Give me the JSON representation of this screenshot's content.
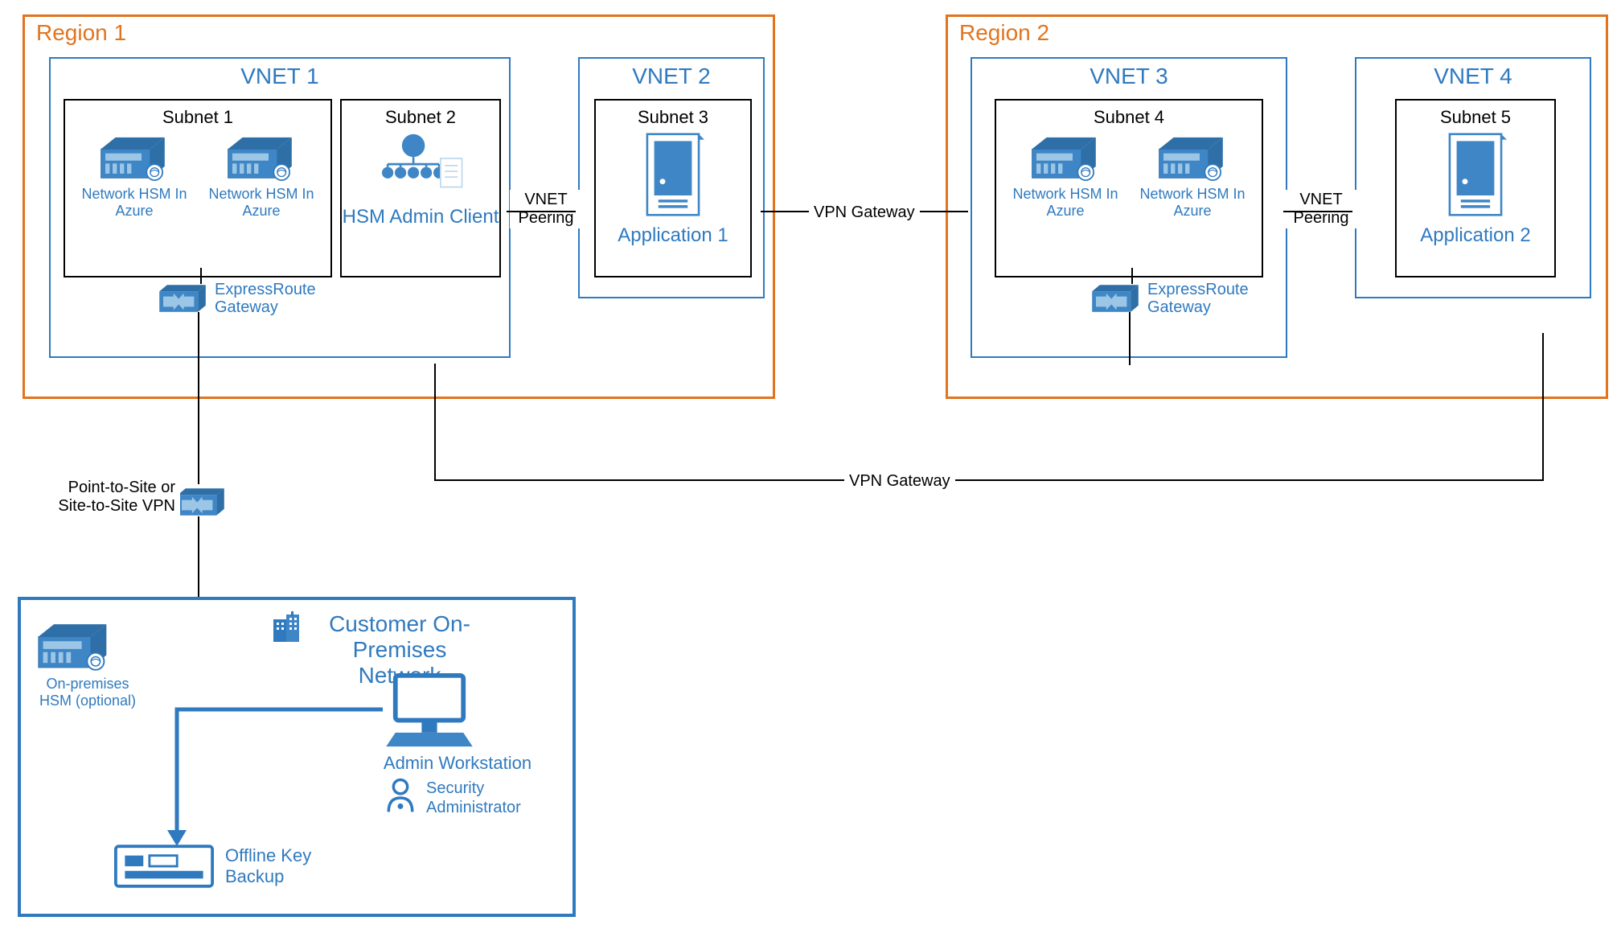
{
  "regions": [
    {
      "id": "region1",
      "title": "Region 1"
    },
    {
      "id": "region2",
      "title": "Region 2"
    }
  ],
  "vnets": {
    "vnet1": {
      "title": "VNET 1"
    },
    "vnet2": {
      "title": "VNET 2"
    },
    "vnet3": {
      "title": "VNET 3"
    },
    "vnet4": {
      "title": "VNET 4"
    }
  },
  "subnets": {
    "s1": {
      "title": "Subnet 1"
    },
    "s2": {
      "title": "Subnet 2"
    },
    "s3": {
      "title": "Subnet 3"
    },
    "s4": {
      "title": "Subnet 4"
    },
    "s5": {
      "title": "Subnet 5"
    }
  },
  "resources": {
    "hsm_caption": "Network HSM In Azure",
    "admin_client": "HSM Admin Client",
    "app1": "Application 1",
    "app2": "Application 2",
    "er_gateway": "ExpressRoute Gateway",
    "onprem_hsm": "On-premises HSM (optional)",
    "onprem_title": "Customer On-Premises Network",
    "admin_ws": "Admin Workstation",
    "sec_admin": "Security Administrator",
    "offline_backup": "Offline Key Backup",
    "vpn_box_label": "Point-to-Site or Site-to-Site VPN"
  },
  "connections": {
    "vnet_peering": "VNET Peering",
    "vpn_gateway": "VPN Gateway"
  },
  "colors": {
    "accent_orange": "#E2741E",
    "accent_blue": "#2F7ABF",
    "fill_blue": "#3F86C6",
    "light_blue": "#9CC6E6"
  }
}
